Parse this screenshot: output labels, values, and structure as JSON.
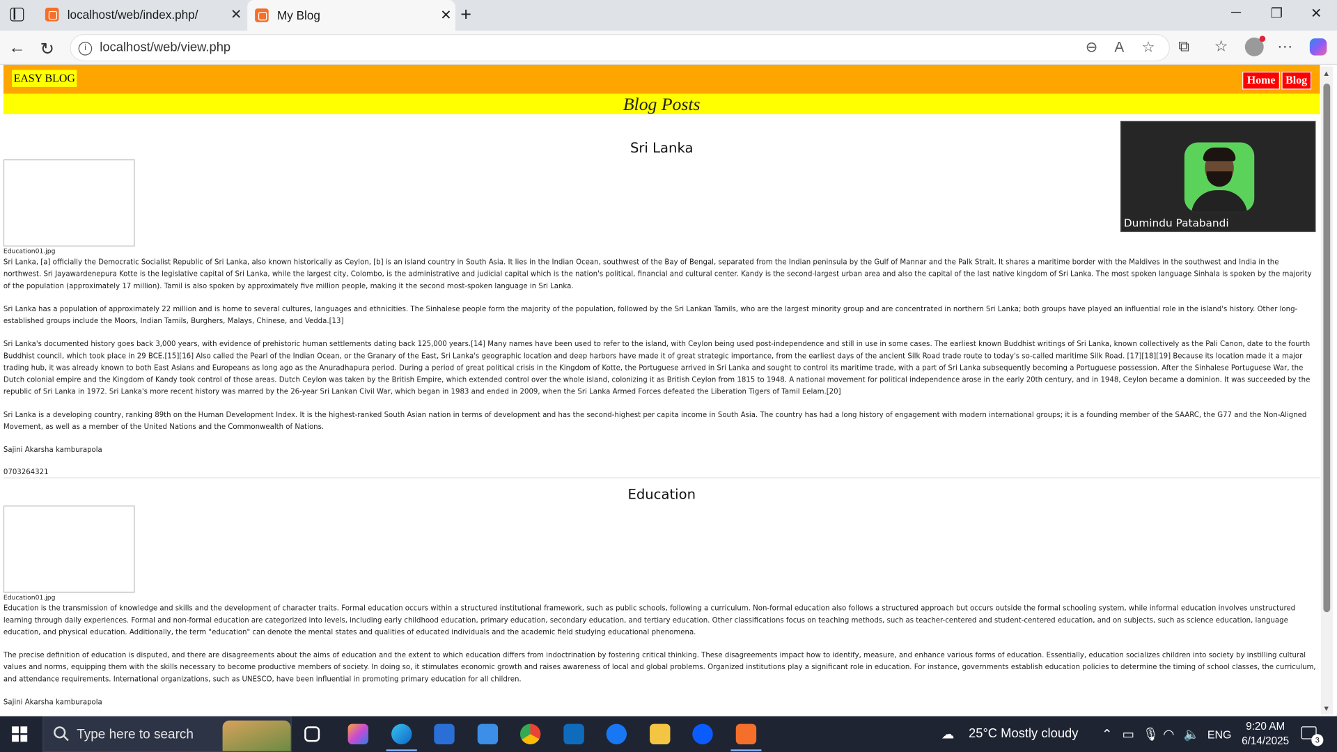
{
  "browser": {
    "tabs": [
      {
        "title": "localhost/web/index.php/",
        "active": false
      },
      {
        "title": "My Blog",
        "active": true
      }
    ],
    "url": "localhost/web/view.php",
    "tab_close_glyph": "✕",
    "new_tab_glyph": "+"
  },
  "site": {
    "brand": "EASY BLOG",
    "nav": [
      "Home",
      "Blog"
    ],
    "page_heading": "Blog Posts",
    "colors": {
      "header": "#ffa500",
      "subheader": "#ffff00",
      "nav_button": "#ff0000"
    }
  },
  "posts": [
    {
      "title": "Sri Lanka",
      "image_caption": "Education01.jpg",
      "paragraphs": [
        "Sri Lanka, [a] officially the Democratic Socialist Republic of Sri Lanka, also known historically as Ceylon, [b] is an island country in South Asia. It lies in the Indian Ocean, southwest of the Bay of Bengal, separated from the Indian peninsula by the Gulf of Mannar and the Palk Strait. It shares a maritime border with the Maldives in the southwest and India in the northwest. Sri Jayawardenepura Kotte is the legislative capital of Sri Lanka, while the largest city, Colombo, is the administrative and judicial capital which is the nation's political, financial and cultural center. Kandy is the second-largest urban area and also the capital of the last native kingdom of Sri Lanka. The most spoken language Sinhala is spoken by the majority of the population (approximately 17 million). Tamil is also spoken by approximately five million people, making it the second most-spoken language in Sri Lanka.",
        "Sri Lanka has a population of approximately 22 million and is home to several cultures, languages and ethnicities. The Sinhalese people form the majority of the population, followed by the Sri Lankan Tamils, who are the largest minority group and are concentrated in northern Sri Lanka; both groups have played an influential role in the island's history. Other long-established groups include the Moors, Indian Tamils, Burghers, Malays, Chinese, and Vedda.[13]",
        "Sri Lanka's documented history goes back 3,000 years, with evidence of prehistoric human settlements dating back 125,000 years.[14] Many names have been used to refer to the island, with Ceylon being used post-independence and still in use in some cases. The earliest known Buddhist writings of Sri Lanka, known collectively as the Pali Canon, date to the fourth Buddhist council, which took place in 29 BCE.[15][16] Also called the Pearl of the Indian Ocean, or the Granary of the East, Sri Lanka's geographic location and deep harbors have made it of great strategic importance, from the earliest days of the ancient Silk Road trade route to today's so-called maritime Silk Road. [17][18][19] Because its location made it a major trading hub, it was already known to both East Asians and Europeans as long ago as the Anuradhapura period. During a period of great political crisis in the Kingdom of Kotte, the Portuguese arrived in Sri Lanka and sought to control its maritime trade, with a part of Sri Lanka subsequently becoming a Portuguese possession. After the Sinhalese Portuguese War, the Dutch colonial empire and the Kingdom of Kandy took control of those areas. Dutch Ceylon was taken by the British Empire, which extended control over the whole island, colonizing it as British Ceylon from 1815 to 1948. A national movement for political independence arose in the early 20th century, and in 1948, Ceylon became a dominion. It was succeeded by the republic of Sri Lanka in 1972. Sri Lanka's more recent history was marred by the 26-year Sri Lankan Civil War, which began in 1983 and ended in 2009, when the Sri Lanka Armed Forces defeated the Liberation Tigers of Tamil Eelam.[20]",
        "Sri Lanka is a developing country, ranking 89th on the Human Development Index. It is the highest-ranked South Asian nation in terms of development and has the second-highest per capita income in South Asia. The country has had a long history of engagement with modern international groups; it is a founding member of the SAARC, the G77 and the Non-Aligned Movement, as well as a member of the United Nations and the Commonwealth of Nations."
      ],
      "author": "Sajini Akarsha kamburapola",
      "phone": "0703264321"
    },
    {
      "title": "Education",
      "image_caption": "Education01.jpg",
      "paragraphs": [
        "Education is the transmission of knowledge and skills and the development of character traits. Formal education occurs within a structured institutional framework, such as public schools, following a curriculum. Non-formal education also follows a structured approach but occurs outside the formal schooling system, while informal education involves unstructured learning through daily experiences. Formal and non-formal education are categorized into levels, including early childhood education, primary education, secondary education, and tertiary education. Other classifications focus on teaching methods, such as teacher-centered and student-centered education, and on subjects, such as science education, language education, and physical education. Additionally, the term \"education\" can denote the mental states and qualities of educated individuals and the academic field studying educational phenomena.",
        "The precise definition of education is disputed, and there are disagreements about the aims of education and the extent to which education differs from indoctrination by fostering critical thinking. These disagreements impact how to identify, measure, and enhance various forms of education. Essentially, education socializes children into society by instilling cultural values and norms, equipping them with the skills necessary to become productive members of society. In doing so, it stimulates economic growth and raises awareness of local and global problems. Organized institutions play a significant role in education. For instance, governments establish education policies to determine the timing of school classes, the curriculum, and attendance requirements. International organizations, such as UNESCO, have been influential in promoting primary education for all children."
      ],
      "author": "Sajini Akarsha kamburapola"
    }
  ],
  "video_overlay": {
    "name": "Dumindu Patabandi"
  },
  "taskbar": {
    "search_placeholder": "Type here to search",
    "weather": "25°C  Mostly cloudy",
    "language": "ENG",
    "time": "9:20 AM",
    "date": "6/14/2025",
    "notification_count": "3"
  }
}
